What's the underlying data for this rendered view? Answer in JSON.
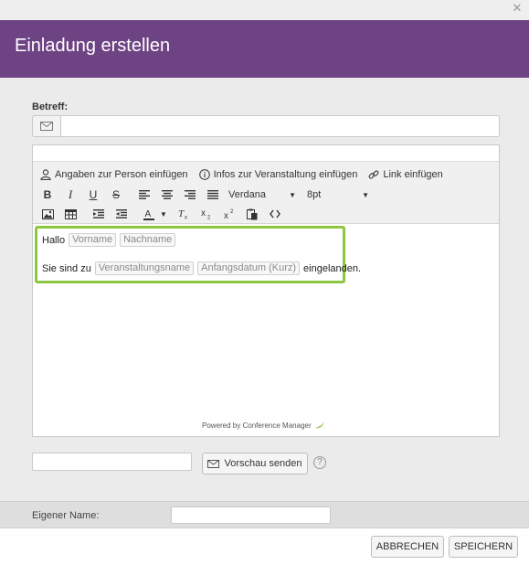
{
  "window": {
    "close_icon": "close-icon",
    "title": "Einladung erstellen"
  },
  "subject": {
    "label": "Betreff:",
    "icon": "envelope-icon",
    "value": ""
  },
  "toolbar": {
    "insert_person": "Angaben zur Person einfügen",
    "insert_event": "Infos zur Veranstaltung einfügen",
    "insert_link": "Link einfügen",
    "bold": "B",
    "italic": "I",
    "underline": "U",
    "strike": "S",
    "font": "Verdana",
    "size": "8pt"
  },
  "editor": {
    "line1_text": "Hallo",
    "tag_firstname": "Vorname",
    "tag_lastname": "Nachname",
    "line2_text": "Sie sind zu",
    "tag_eventname": "Veranstaltungsname",
    "tag_startdate": "Anfangsdatum (Kurz)",
    "line2_end": "eingelanden.",
    "powered_by": "Powered by Conference Manager"
  },
  "preview": {
    "input_value": "",
    "button_label": "Vorschau senden",
    "help": "?"
  },
  "own_name": {
    "label": "Eigener Name:",
    "value": ""
  },
  "footer": {
    "cancel_label": "ABBRECHEN",
    "save_label": "SPEICHERN"
  },
  "colors": {
    "header_bg": "#6e4384",
    "template_border": "#8dc63f",
    "body_bg": "#ebebeb"
  }
}
